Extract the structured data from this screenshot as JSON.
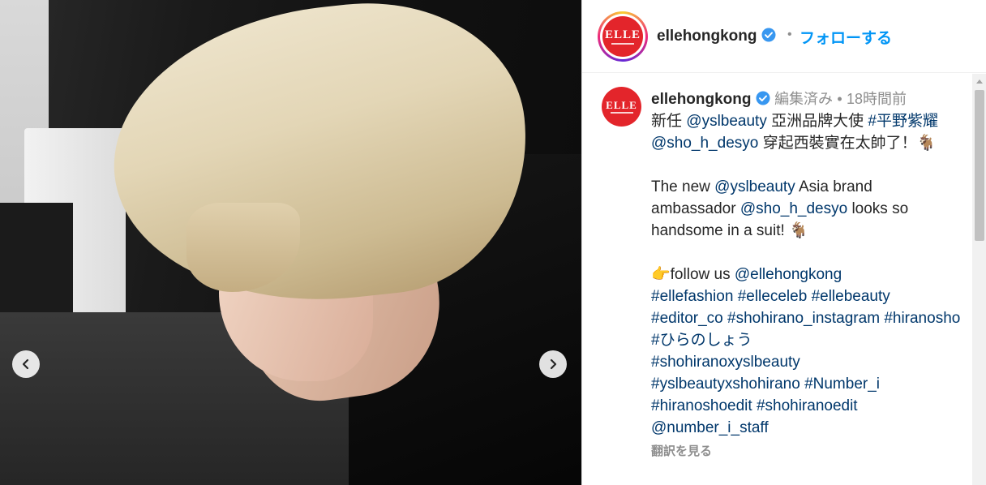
{
  "photo": {
    "prev_icon": "chevron-left-icon",
    "next_icon": "chevron-right-icon"
  },
  "header": {
    "avatar_logo": "ELLE",
    "username": "ellehongkong",
    "verified_icon": "verified-badge-icon",
    "separator": "•",
    "follow_label": "フォローする"
  },
  "caption": {
    "avatar_logo": "ELLE",
    "username": "ellehongkong",
    "edited": "編集済み",
    "separator": "•",
    "time": "18時間前",
    "line1_a": "新任 ",
    "line1_mention": "@yslbeauty",
    "line1_b": " 亞洲品牌大使 ",
    "line1_tag": "#平野紫耀",
    "line1_c": " ",
    "line1_mention2": "@sho_h_desyo",
    "line1_d": " 穿起西裝實在太帥了！🐐",
    "en_a": "The new ",
    "en_mention": "@yslbeauty",
    "en_b": " Asia brand ambassador ",
    "en_mention2": "@sho_h_desyo",
    "en_c": " looks so handsome in a suit! 🐐",
    "follow_a": "👉follow us ",
    "follow_mention": "@ellehongkong",
    "tags": [
      "#ellefashion",
      "#elleceleb",
      "#ellebeauty",
      "#editor_co",
      "#shohirano_instagram",
      "#hiranosho",
      "#ひらのしょう",
      "#shohiranoxyslbeauty",
      "#yslbeautyxshohirano",
      "#Number_i",
      "#hiranoshoedit",
      "#shohiranoedit"
    ],
    "staff_mention": "@number_i_staff",
    "translate_label": "翻訳を見る"
  },
  "colors": {
    "link": "#00376b",
    "follow": "#0095f6",
    "brand_red": "#e3252b",
    "verified": "#3897f0"
  }
}
